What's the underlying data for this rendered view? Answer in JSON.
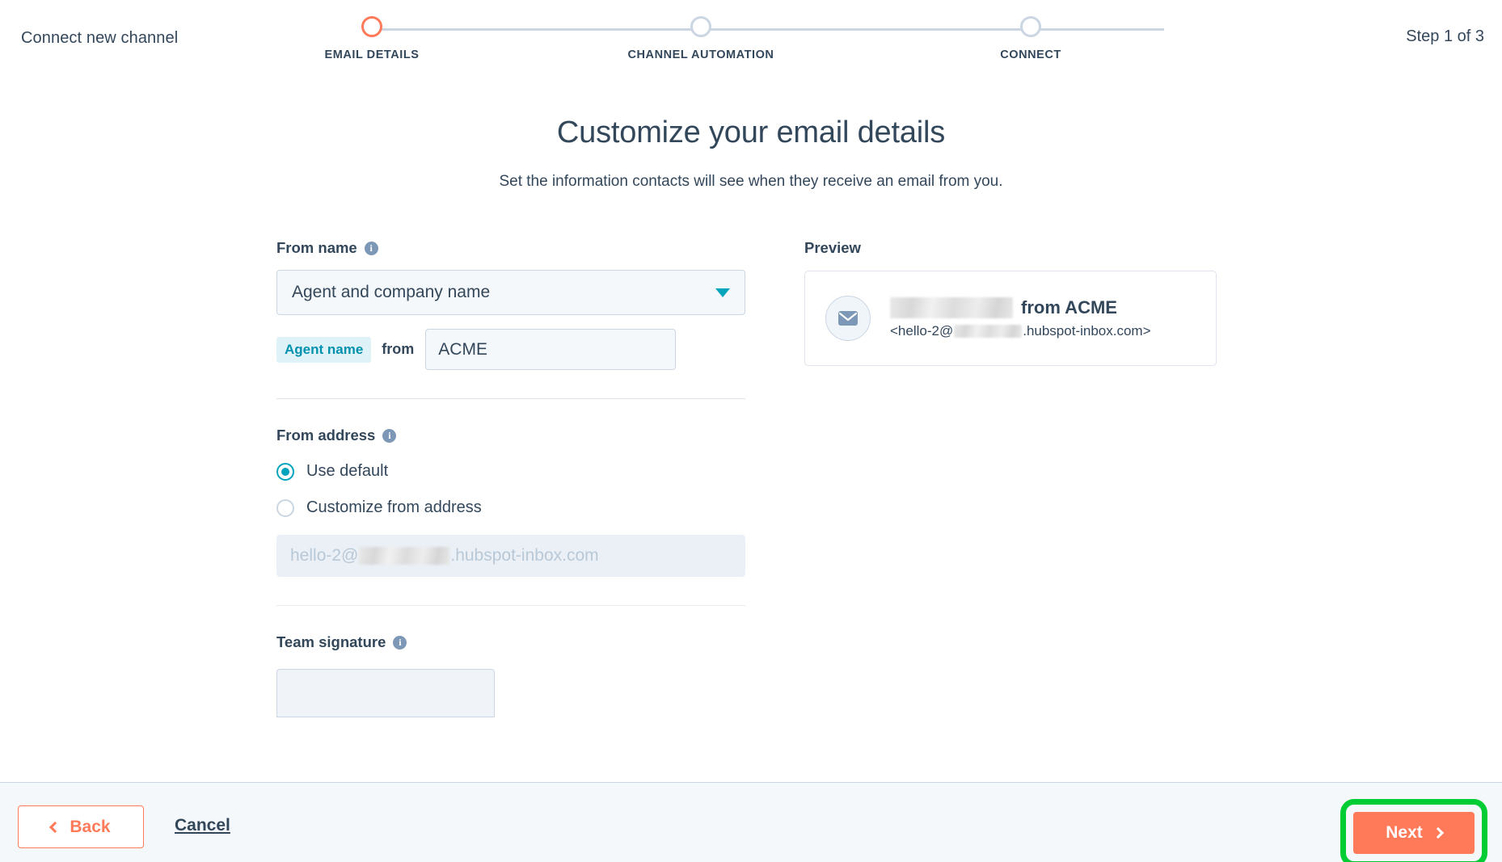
{
  "header": {
    "title": "Connect new channel",
    "step_counter": "Step 1 of 3",
    "steps": [
      {
        "label": "EMAIL DETAILS",
        "state": "active"
      },
      {
        "label": "CHANNEL AUTOMATION",
        "state": "inactive"
      },
      {
        "label": "CONNECT",
        "state": "inactive"
      }
    ]
  },
  "main": {
    "heading": "Customize your email details",
    "subheading": "Set the information contacts will see when they receive an email from you.",
    "from_name": {
      "label": "From name",
      "info_icon": "info-icon",
      "select_value": "Agent and company name",
      "caret_icon": "chevron-down-icon",
      "token_chip": "Agent name",
      "token_from": "from",
      "company_value": "ACME"
    },
    "from_address": {
      "label": "From address",
      "info_icon": "info-icon",
      "options": [
        {
          "label": "Use default",
          "selected": true
        },
        {
          "label": "Customize from address",
          "selected": false
        }
      ],
      "address_prefix": "hello-2@",
      "address_suffix": ".hubspot-inbox.com"
    },
    "team_signature": {
      "label": "Team signature",
      "info_icon": "info-icon"
    },
    "preview": {
      "label": "Preview",
      "avatar_icon": "envelope-icon",
      "name_suffix": "from ACME",
      "email_open": "<hello-2@",
      "email_close": ".hubspot-inbox.com>"
    }
  },
  "footer": {
    "back_label": "Back",
    "cancel_label": "Cancel",
    "next_label": "Next"
  },
  "colors": {
    "accent_orange": "#ff7a59",
    "teal": "#00a4bd",
    "text_dark": "#33475b",
    "border": "#cbd6e2",
    "field_bg": "#f5f8fa",
    "highlight_green": "#00cc33"
  }
}
